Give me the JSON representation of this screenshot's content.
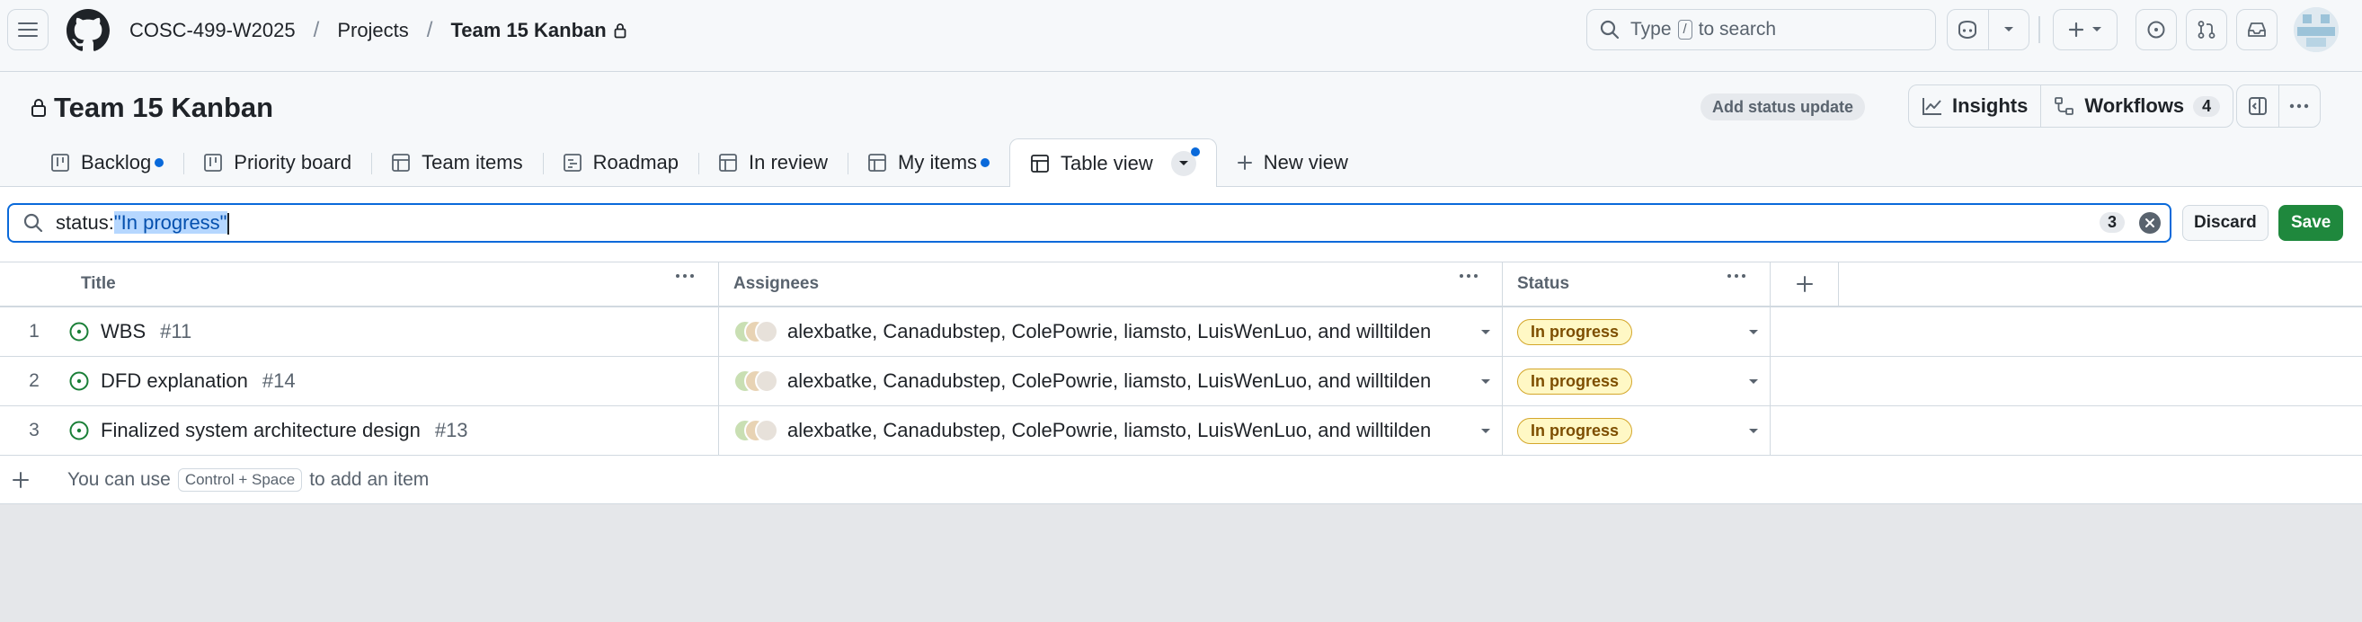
{
  "topbar": {
    "org": "COSC-499-W2025",
    "projects": "Projects",
    "project": "Team 15 Kanban",
    "search_prefix": "Type",
    "search_key": "/",
    "search_suffix": "to search"
  },
  "project_header": {
    "title": "Team 15 Kanban",
    "status_update": "Add status update",
    "insights": "Insights",
    "workflows": "Workflows",
    "workflows_count": "4"
  },
  "tabs": [
    {
      "label": "Backlog",
      "icon": "board-icon"
    },
    {
      "label": "Priority board",
      "icon": "board-icon"
    },
    {
      "label": "Team items",
      "icon": "table-icon"
    },
    {
      "label": "Roadmap",
      "icon": "roadmap-icon"
    },
    {
      "label": "In review",
      "icon": "table-icon"
    },
    {
      "label": "My items",
      "icon": "table-icon"
    },
    {
      "label": "Table view",
      "icon": "table-icon"
    },
    {
      "label": "New view",
      "icon": "plus-icon"
    }
  ],
  "filter": {
    "prefix": "status:",
    "selected": "\"In progress\"",
    "count": "3",
    "discard": "Discard",
    "save": "Save"
  },
  "columns": {
    "title": "Title",
    "assignees": "Assignees",
    "status": "Status"
  },
  "rows": [
    {
      "index": "1",
      "title": "WBS",
      "number": "#11",
      "assignees": "alexbatke, Canadubstep, ColePowrie, liamsto, LuisWenLuo, and willtilden",
      "status": "In progress"
    },
    {
      "index": "2",
      "title": "DFD explanation",
      "number": "#14",
      "assignees": "alexbatke, Canadubstep, ColePowrie, liamsto, LuisWenLuo, and willtilden",
      "status": "In progress"
    },
    {
      "index": "3",
      "title": "Finalized system architecture design",
      "number": "#13",
      "assignees": "alexbatke, Canadubstep, ColePowrie, liamsto, LuisWenLuo, and willtilden",
      "status": "In progress"
    }
  ],
  "add_item": {
    "before": "You can use",
    "shortcut": "Control + Space",
    "after": "to add an item"
  },
  "colors": {
    "accent": "#0969da",
    "save_green": "#1f883d",
    "open_issue": "#1a7f37",
    "in_progress_bg": "#fff8c5"
  }
}
